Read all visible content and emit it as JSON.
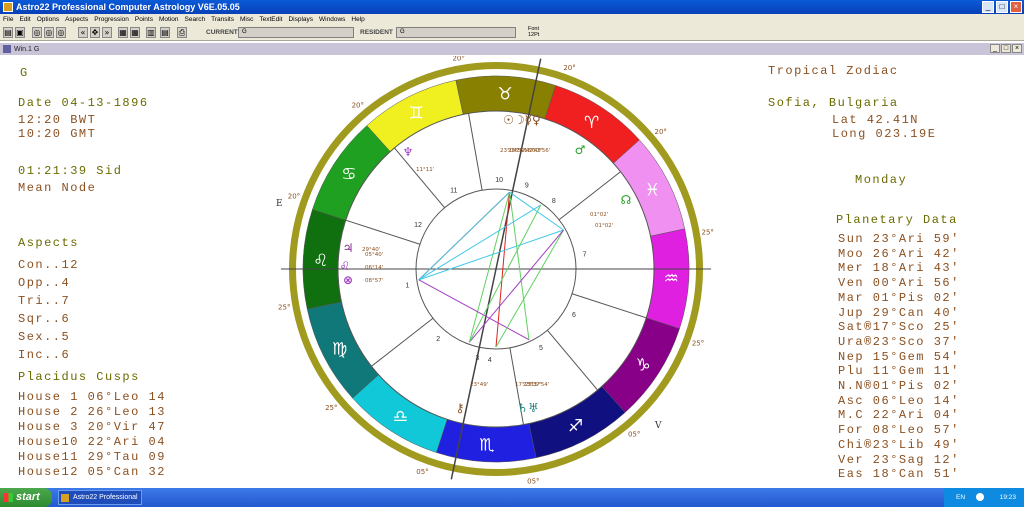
{
  "window": {
    "title": "Astro22 Professional Computer Astrology V6E.05.05"
  },
  "menu": [
    "File",
    "Edit",
    "Options",
    "Aspects",
    "Progression",
    "Points",
    "Motion",
    "Search",
    "Transits",
    "Misc",
    "TextEdit",
    "Displays",
    "Windows",
    "Help"
  ],
  "toolbar": {
    "current_label": "CURRENT",
    "current_value": "G",
    "resident_label": "RESIDENT",
    "resident_value": "G",
    "font_label_1": "Font",
    "font_label_2": "12Pt"
  },
  "child_window": {
    "title": "Win.1  G"
  },
  "left_panel": {
    "name": "G",
    "date": "Date 04-13-1896",
    "local_time": "12:20 BWT",
    "gmt_time": "10:20 GMT",
    "sidereal": "01:21:39 Sid",
    "node": "Mean Node",
    "aspects_title": "Aspects",
    "aspects": [
      "Con..12",
      "Opp..4",
      "Tri..7",
      "Sqr..6",
      "Sex..5",
      "Inc..6"
    ],
    "cusps_title": "Placidus Cusps",
    "cusps": [
      "House 1 06°Leo 14",
      "House 2 26°Leo 13",
      "House 3 20°Vir 47",
      "House10 22°Ari 04",
      "House11 29°Tau 09",
      "House12 05°Can 32"
    ]
  },
  "right_panel": {
    "zodiac": "Tropical Zodiac",
    "place": "Sofia, Bulgaria",
    "lat": "Lat  42.41N",
    "long": "Long 023.19E",
    "weekday": "Monday",
    "planetary_title": "Planetary Data",
    "planets": [
      "Sun 23°Ari 59'",
      "Moo 26°Ari 42'",
      "Mer 18°Ari 43'",
      "Ven 00°Ari 56'",
      "Mar 01°Pis 02'",
      "Jup 29°Can 40'",
      "Sat®17°Sco 25'",
      "Ura®23°Sco 37'",
      "Nep 15°Gem 54'",
      "Plu 11°Gem 11'",
      "N.N®01°Pis 02'",
      "Asc 06°Leo 14'",
      "M.C 22°Ari 04'",
      "For 08°Leo 57'",
      "Chi®23°Lib 49'",
      "Ver 23°Sag 12'",
      "Eas 18°Can 51'"
    ]
  },
  "wheel": {
    "colors": {
      "rim": "#a09a1e",
      "planet_text": "#8a5020",
      "aspect_red": "#e02020",
      "aspect_green": "#60d060",
      "aspect_cyan": "#40c8e8",
      "aspect_purple": "#a040c0"
    },
    "signs": [
      {
        "glyph": "♈",
        "color": "#f02020",
        "icon": "aries-icon"
      },
      {
        "glyph": "♓",
        "color": "#f090f0",
        "icon": "pisces-icon"
      },
      {
        "glyph": "♒",
        "color": "#e020e0",
        "icon": "aquarius-icon"
      },
      {
        "glyph": "♑",
        "color": "#880088",
        "icon": "capricorn-icon"
      },
      {
        "glyph": "♐",
        "color": "#101080",
        "icon": "sagittarius-icon"
      },
      {
        "glyph": "♏",
        "color": "#2020e0",
        "icon": "scorpio-icon"
      },
      {
        "glyph": "♎",
        "color": "#10c8d8",
        "icon": "libra-icon"
      },
      {
        "glyph": "♍",
        "color": "#107878",
        "icon": "virgo-icon"
      },
      {
        "glyph": "♌",
        "color": "#107010",
        "icon": "leo-icon"
      },
      {
        "glyph": "♋",
        "color": "#20a020",
        "icon": "cancer-icon"
      },
      {
        "glyph": "♊",
        "color": "#f0f020",
        "icon": "gemini-icon"
      },
      {
        "glyph": "♉",
        "color": "#888000",
        "icon": "taurus-icon"
      }
    ],
    "house_numbers": [
      "10",
      "11",
      "12",
      "1",
      "2",
      "3",
      "4",
      "5",
      "6",
      "7",
      "8",
      "9"
    ],
    "rim_labels": [
      "20°",
      "20°",
      "20°",
      "25°",
      "25°",
      "05°",
      "05°",
      "05°",
      "25°",
      "25°",
      "20°",
      "20°"
    ],
    "axis_labels": {
      "east": "E",
      "west": "V"
    },
    "planet_glyphs": [
      {
        "glyph": "☉☽☿♀",
        "icon": "sun-moon-mercury-venus-icon",
        "color": "#8a5020"
      },
      {
        "glyph": "♆",
        "icon": "neptune-icon",
        "color": "#a040c0"
      },
      {
        "glyph": "♃",
        "icon": "jupiter-icon",
        "color": "#802080"
      },
      {
        "glyph": "♌",
        "icon": "ascendant-icon",
        "color": "#a040c0"
      },
      {
        "glyph": "⊗",
        "icon": "fortune-icon",
        "color": "#a040c0"
      },
      {
        "glyph": "♂",
        "icon": "mars-icon",
        "color": "#20a020"
      },
      {
        "glyph": "☊",
        "icon": "node-icon",
        "color": "#20a020"
      },
      {
        "glyph": "♄♅",
        "icon": "saturn-uranus-icon",
        "color": "#208080"
      },
      {
        "glyph": "⚷",
        "icon": "chiron-icon",
        "color": "#8a5020"
      }
    ],
    "degree_labels": [
      "29°40'",
      "11°11'",
      "23°04'",
      "23°59'",
      "26°42'",
      "18°43'",
      "00°56'",
      "01°02'",
      "01°02'",
      "05°40'",
      "06°14'",
      "08°57'",
      "23°49'",
      "17°25'",
      "23°37'",
      "15°54'"
    ]
  }
}
